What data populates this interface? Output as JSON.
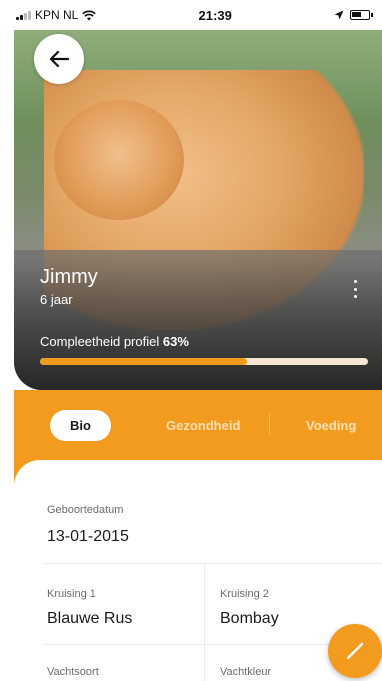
{
  "status_bar": {
    "carrier": "KPN NL",
    "time": "21:39",
    "wifi_icon": "wifi-icon",
    "location_icon": "location-arrow-icon",
    "battery_icon": "battery-icon"
  },
  "header": {
    "back_icon": "arrow-left-icon",
    "pet_name": "Jimmy",
    "pet_age": "6 jaar",
    "more_icon": "more-vertical-icon",
    "profile_progress_label": "Compleetheid profiel",
    "profile_progress_value": "63%",
    "profile_progress_fraction": 0.63
  },
  "tabs": [
    {
      "label": "Bio",
      "active": true
    },
    {
      "label": "Gezondheid",
      "active": false
    },
    {
      "label": "Voeding",
      "active": false
    }
  ],
  "bio": {
    "birthdate": {
      "label": "Geboortedatum",
      "value": "13-01-2015"
    },
    "breed1": {
      "label": "Kruising 1",
      "value": "Blauwe Rus"
    },
    "breed2": {
      "label": "Kruising 2",
      "value": "Bombay"
    },
    "coat_type": {
      "label": "Vachtsoort"
    },
    "coat_color": {
      "label": "Vachtkleur"
    }
  },
  "fab": {
    "icon": "pencil-icon"
  },
  "colors": {
    "accent": "#f39b1e",
    "progress_track": "#f6e7d3"
  }
}
